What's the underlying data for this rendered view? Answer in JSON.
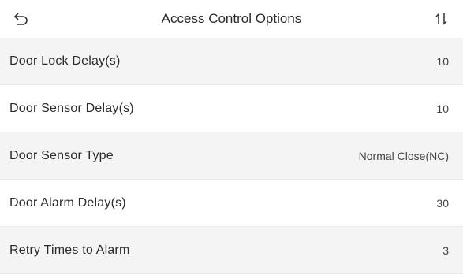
{
  "header": {
    "title": "Access Control Options",
    "back_icon": "back-arrow-icon",
    "sort_icon": "sort-icon"
  },
  "options": [
    {
      "label": "Door Lock Delay(s)",
      "value": "10"
    },
    {
      "label": "Door Sensor Delay(s)",
      "value": "10"
    },
    {
      "label": "Door Sensor Type",
      "value": "Normal Close(NC)"
    },
    {
      "label": "Door Alarm Delay(s)",
      "value": "30"
    },
    {
      "label": "Retry Times to Alarm",
      "value": "3"
    }
  ],
  "colors": {
    "background": "#ffffff",
    "row_alt": "#f4f4f4",
    "text": "#2a2a2a"
  }
}
